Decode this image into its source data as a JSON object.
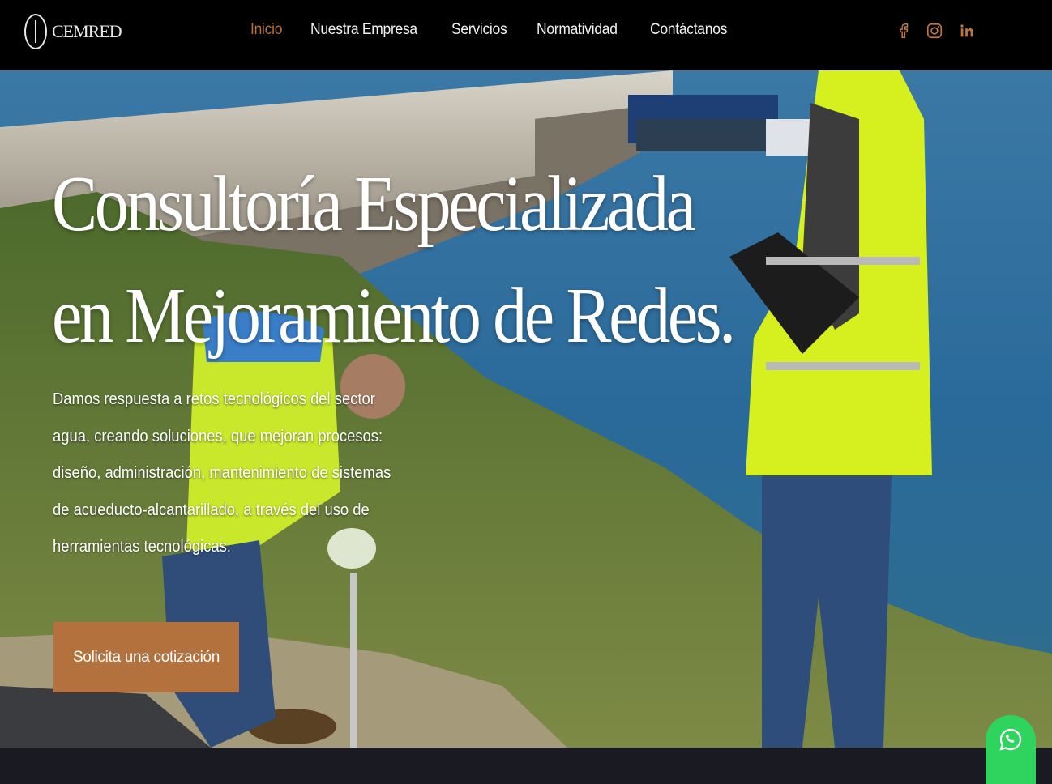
{
  "brand": {
    "name": "CEMRED"
  },
  "nav": {
    "items": [
      {
        "label": "Inicio",
        "active": true
      },
      {
        "label": "Nuestra Empresa",
        "active": false
      },
      {
        "label": "Servicios",
        "active": false
      },
      {
        "label": "Normatividad",
        "active": false
      },
      {
        "label": "Contáctanos",
        "active": false
      }
    ],
    "active_color": "#b8703a"
  },
  "social": [
    {
      "icon": "facebook-icon"
    },
    {
      "icon": "instagram-icon"
    },
    {
      "icon": "linkedin-icon"
    }
  ],
  "hero": {
    "title_line1": "Consultoría Especializada",
    "title_line2": "en Mejoramiento de Redes.",
    "description": "Damos respuesta a retos tecnológicos del sector agua, creando soluciones, que mejoran procesos: diseño, administración, mantenimiento de sistemas de acueducto-alcantarillado, a través del uso de herramientas tecnológicas.",
    "cta_label": "Solicita una cotización",
    "cta_color": "#b3723d"
  },
  "whatsapp": {
    "icon": "whatsapp-icon",
    "color": "#2fd45f"
  }
}
